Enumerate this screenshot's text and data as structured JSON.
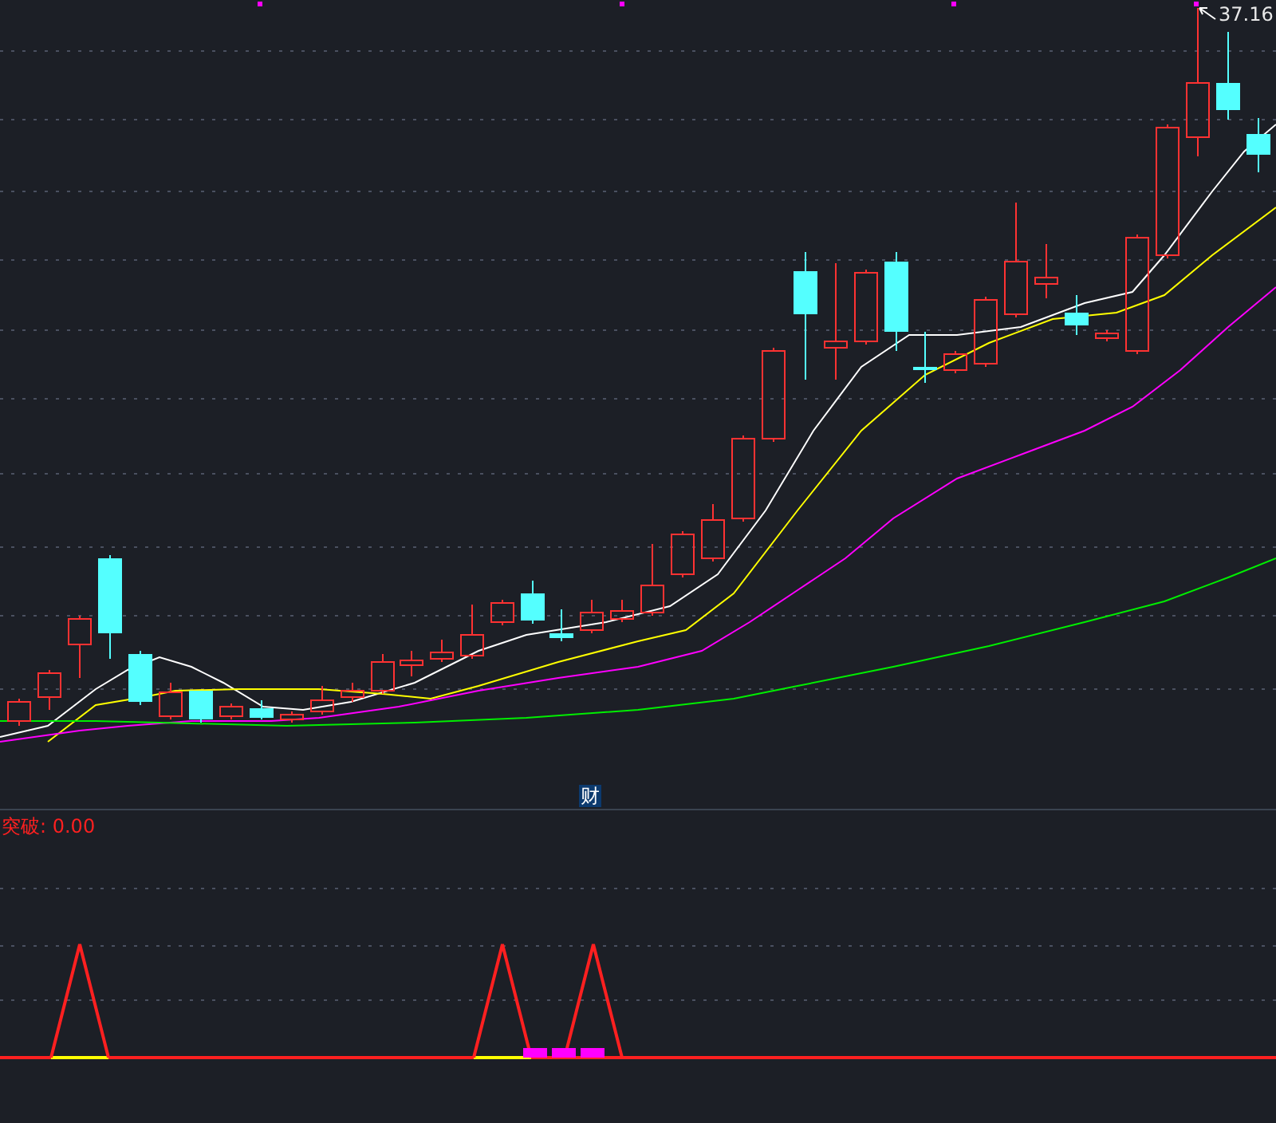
{
  "price_chart": {
    "high_label": "37.16",
    "badge": "财"
  },
  "indicator": {
    "label": "突破: 0.00"
  }
}
